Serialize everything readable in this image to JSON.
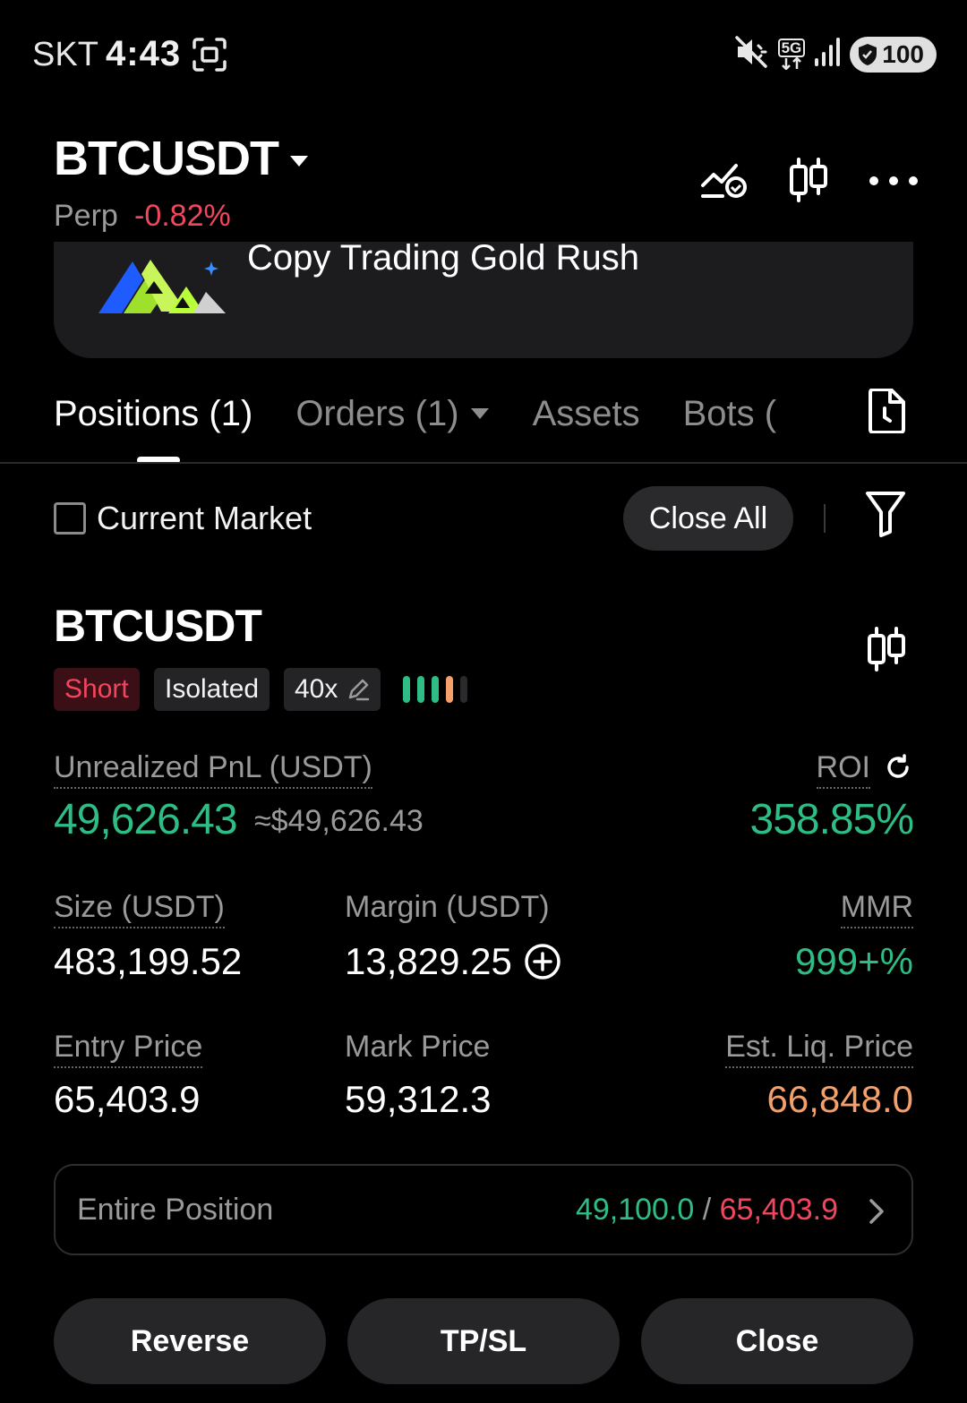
{
  "status_bar": {
    "carrier": "SKT",
    "time": "4:43",
    "network": "5G",
    "battery": "100"
  },
  "header": {
    "symbol": "BTCUSDT",
    "contract_type": "Perp",
    "change": "-0.82%"
  },
  "banner": {
    "text": "Copy Trading Gold Rush"
  },
  "tabs": [
    {
      "label": "Positions (1)",
      "active": true
    },
    {
      "label": "Orders (1)",
      "active": false
    },
    {
      "label": "Assets",
      "active": false
    },
    {
      "label": "Bots (",
      "active": false
    }
  ],
  "filter": {
    "current_market_label": "Current Market",
    "current_market_checked": false,
    "close_all_label": "Close All"
  },
  "position": {
    "symbol": "BTCUSDT",
    "side": "Short",
    "margin_mode": "Isolated",
    "leverage": "40x",
    "risk_level_filled": 4,
    "risk_level_total": 5,
    "unrealized_pnl_label": "Unrealized PnL (USDT)",
    "unrealized_pnl": "49,626.43",
    "unrealized_pnl_usd": "≈$49,626.43",
    "roi_label": "ROI",
    "roi": "358.85%",
    "size_label": "Size (USDT)",
    "size": "483,199.52",
    "margin_label": "Margin (USDT)",
    "margin": "13,829.25",
    "mmr_label": "MMR",
    "mmr": "999+%",
    "entry_price_label": "Entry Price",
    "entry_price": "65,403.9",
    "mark_price_label": "Mark Price",
    "mark_price": "59,312.3",
    "liq_price_label": "Est. Liq. Price",
    "liq_price": "66,848.0",
    "entire_position_label": "Entire Position",
    "tp_value": "49,100.0",
    "separator": " / ",
    "sl_value": "65,403.9"
  },
  "actions": {
    "reverse": "Reverse",
    "tpsl": "TP/SL",
    "close": "Close"
  },
  "colors": {
    "positive": "#2ebd85",
    "negative": "#f0475e",
    "warning": "#f5a06a",
    "background": "#000000",
    "surface": "#262628"
  }
}
